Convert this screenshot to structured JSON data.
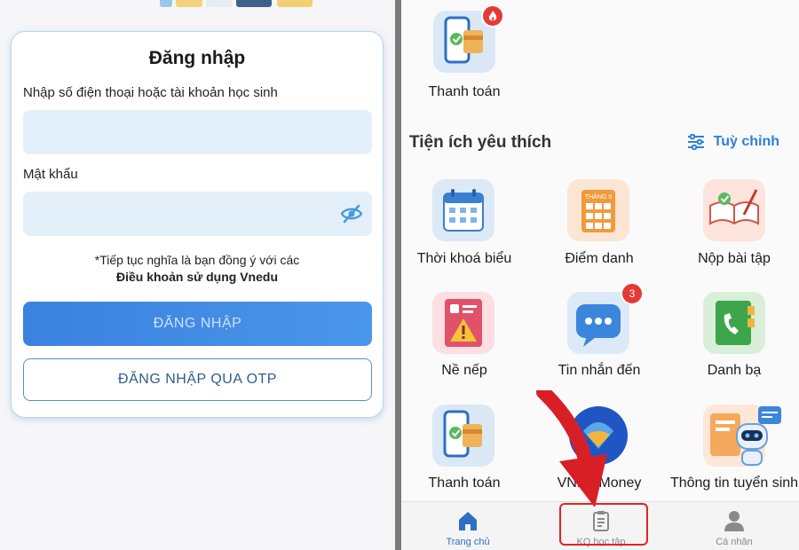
{
  "login": {
    "title": "Đăng nhập",
    "username_label": "Nhập số điện thoại hoặc tài khoản học sinh",
    "username_value": "",
    "password_label": "Mật khẩu",
    "password_value": "",
    "terms_line1": "*Tiếp tục nghĩa là bạn đồng ý với các",
    "terms_line2": "Điều khoản sử dụng Vnedu",
    "login_button": "ĐĂNG NHẬP",
    "otp_button": "ĐĂNG NHẬP QUA OTP",
    "icons": {
      "password_toggle": "eye-off-icon"
    }
  },
  "home": {
    "top_tile": {
      "label": "Thanh toán",
      "icon": "payment-phone-icon",
      "badge_icon": "fire-icon"
    },
    "favorites_title": "Tiện ích yêu thích",
    "customize_label": "Tuỳ chỉnh",
    "customize_icon": "sliders-icon",
    "tiles": [
      {
        "label": "Thời khoá biểu",
        "icon": "calendar-icon"
      },
      {
        "label": "Điểm danh",
        "icon": "attendance-icon",
        "icon_caption": "THÁNG 9"
      },
      {
        "label": "Nộp bài tập",
        "icon": "homework-book-icon"
      },
      {
        "label": "Nề nếp",
        "icon": "conduct-warning-icon"
      },
      {
        "label": "Tin nhắn đến",
        "icon": "message-icon",
        "badge": "3"
      },
      {
        "label": "Danh bạ",
        "icon": "contacts-phone-icon"
      },
      {
        "label": "Thanh toán",
        "icon": "payment-phone-icon"
      },
      {
        "label": "VNPT Money",
        "icon": "vnpt-money-icon"
      },
      {
        "label": "Thông tin tuyển sinh",
        "icon": "admission-robot-icon"
      }
    ],
    "bottom_nav": [
      {
        "label": "Trang chủ",
        "icon": "home-icon",
        "active": true
      },
      {
        "label": "KQ học tập",
        "icon": "clipboard-icon",
        "active": false
      },
      {
        "label": "Cá nhân",
        "icon": "person-icon",
        "active": false
      }
    ],
    "colors": {
      "accent": "#2f7fd8",
      "highlight": "#e02424",
      "badge": "#e53935"
    }
  }
}
